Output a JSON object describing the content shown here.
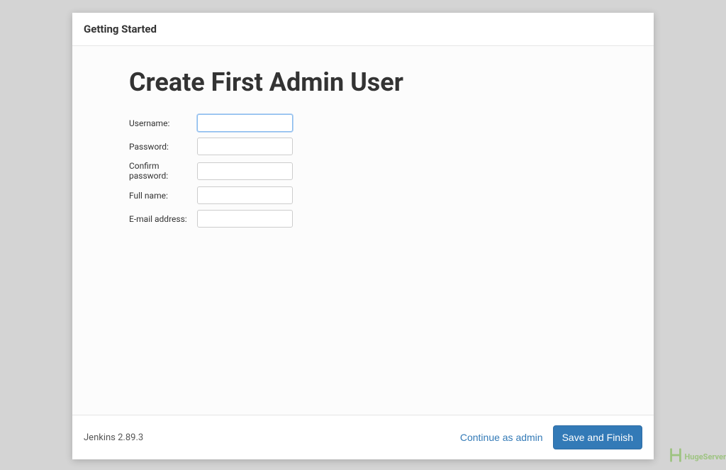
{
  "header": {
    "title": "Getting Started"
  },
  "main": {
    "heading": "Create First Admin User",
    "fields": {
      "username_label": "Username:",
      "password_label": "Password:",
      "confirm_password_label": "Confirm password:",
      "fullname_label": "Full name:",
      "email_label": "E-mail address:"
    }
  },
  "footer": {
    "version": "Jenkins 2.89.3",
    "continue_label": "Continue as admin",
    "save_label": "Save and Finish"
  },
  "watermark": {
    "text": "HugeServer"
  }
}
